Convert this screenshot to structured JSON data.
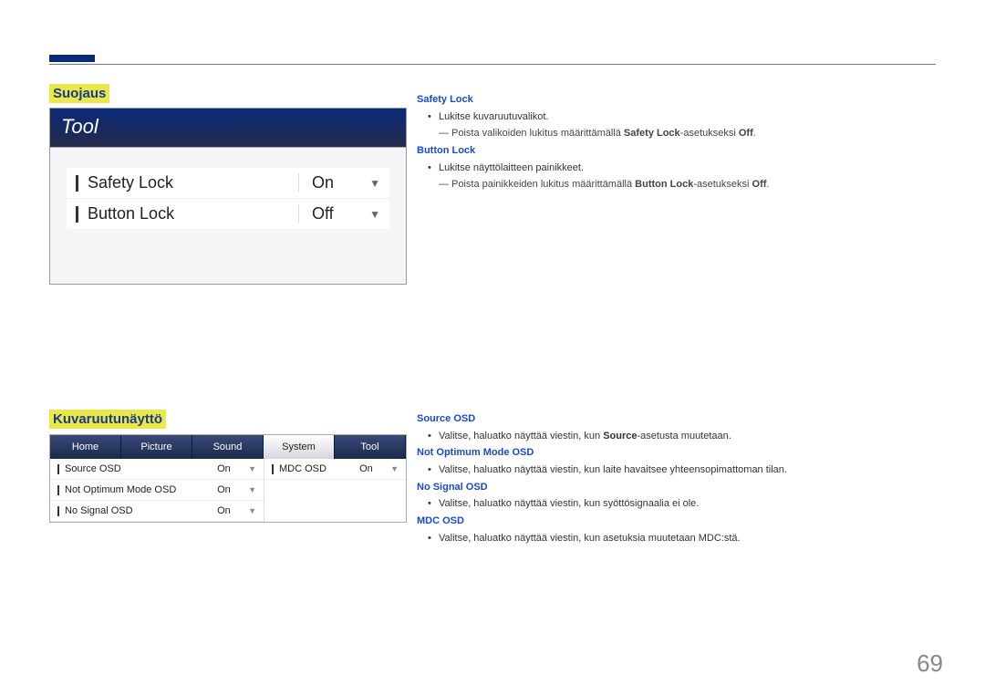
{
  "page_number": "69",
  "sections": {
    "suojaus": {
      "title": "Suojaus",
      "tool_header": "Tool",
      "rows": [
        {
          "label": "Safety Lock",
          "value": "On"
        },
        {
          "label": "Button Lock",
          "value": "Off"
        }
      ]
    },
    "kuvaruutu": {
      "title": "Kuvaruutunäyttö",
      "tabs": [
        "Home",
        "Picture",
        "Sound",
        "System",
        "Tool"
      ],
      "active_tab": "System",
      "left_rows": [
        {
          "label": "Source OSD",
          "value": "On"
        },
        {
          "label": "Not Optimum Mode OSD",
          "value": "On"
        },
        {
          "label": "No Signal OSD",
          "value": "On"
        }
      ],
      "right_rows": [
        {
          "label": "MDC OSD",
          "value": "On"
        }
      ]
    }
  },
  "right_text": {
    "safety_lock": {
      "head": "Safety Lock",
      "bullet": "Lukitse kuvaruutuvalikot.",
      "note_pre": "Poista valikoiden lukitus määrittämällä ",
      "note_bold1": "Safety Lock",
      "note_mid": "-asetukseksi ",
      "note_bold2": "Off",
      "note_end": "."
    },
    "button_lock": {
      "head": "Button Lock",
      "bullet": "Lukitse näyttölaitteen painikkeet.",
      "note_pre": "Poista painikkeiden lukitus määrittämällä ",
      "note_bold1": "Button Lock",
      "note_mid": "-asetukseksi ",
      "note_bold2": "Off",
      "note_end": "."
    },
    "source_osd": {
      "head": "Source OSD",
      "bullet_pre": "Valitse, haluatko näyttää viestin, kun ",
      "bullet_bold": "Source",
      "bullet_post": "-asetusta muutetaan."
    },
    "not_optimum": {
      "head": "Not Optimum Mode OSD",
      "bullet": "Valitse, haluatko näyttää viestin, kun laite havaitsee yhteensopimattoman tilan."
    },
    "no_signal": {
      "head": "No Signal OSD",
      "bullet": "Valitse, haluatko näyttää viestin, kun syöttösignaalia ei ole."
    },
    "mdc_osd": {
      "head": "MDC OSD",
      "bullet": "Valitse, haluatko näyttää viestin, kun asetuksia muutetaan MDC:stä."
    }
  }
}
